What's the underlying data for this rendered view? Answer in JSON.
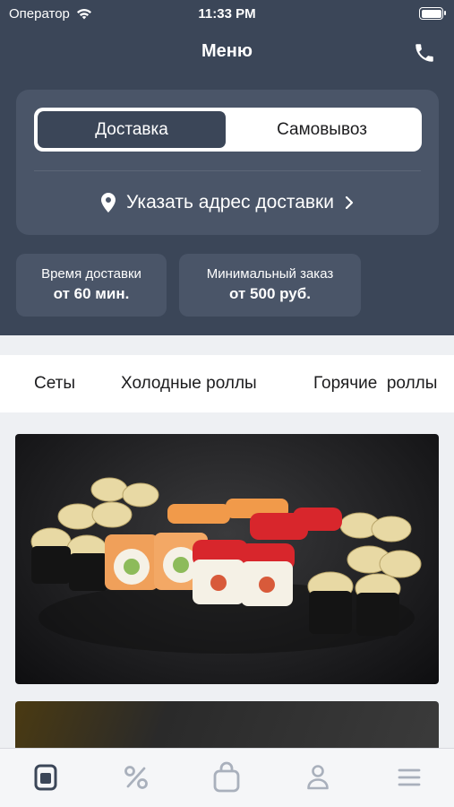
{
  "status_bar": {
    "carrier": "Оператор",
    "time": "11:33 PM"
  },
  "nav": {
    "title": "Меню"
  },
  "delivery_mode": {
    "options": [
      "Доставка",
      "Самовывоз"
    ],
    "selected": "Доставка"
  },
  "address": {
    "label": "Указать адрес доставки"
  },
  "info": {
    "delivery_time": {
      "label": "Время доставки",
      "value": "от 60 мин."
    },
    "min_order": {
      "label": "Минимальный заказ",
      "value": "от 500 руб."
    }
  },
  "categories": [
    "Сеты",
    "Холодные роллы",
    "Горячие  роллы"
  ],
  "tabs": [
    "menu-icon",
    "percent-icon",
    "bag-icon",
    "profile-icon",
    "hamburger-icon"
  ],
  "colors": {
    "header_bg": "#3b4658",
    "card_bg": "#4a5568",
    "tab_active": "#3b4658",
    "tab_inactive": "#a9b0bc"
  }
}
